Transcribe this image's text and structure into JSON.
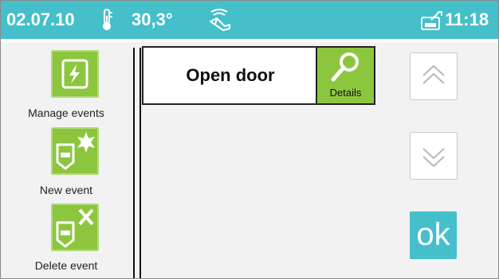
{
  "status_bar": {
    "date": "02.07.10",
    "temperature": "30,3°",
    "time": "11:18",
    "icons": [
      "thermometer-icon",
      "hand-wave-icon",
      "mailbox-icon"
    ]
  },
  "sidebar": {
    "items": [
      {
        "label": "Manage events",
        "icon": "lightning-icon"
      },
      {
        "label": "New event",
        "icon": "event-new-icon"
      },
      {
        "label": "Delete event",
        "icon": "event-delete-icon"
      }
    ]
  },
  "list": {
    "rows": [
      {
        "title": "Open door",
        "details_label": "Details",
        "details_icon": "key-icon"
      }
    ]
  },
  "controls": {
    "ok_label": "ok",
    "up_icon": "double-chevron-up-icon",
    "down_icon": "double-chevron-down-icon"
  },
  "colors": {
    "accent": "#45bfca",
    "tile_green": "#8cc63f"
  }
}
